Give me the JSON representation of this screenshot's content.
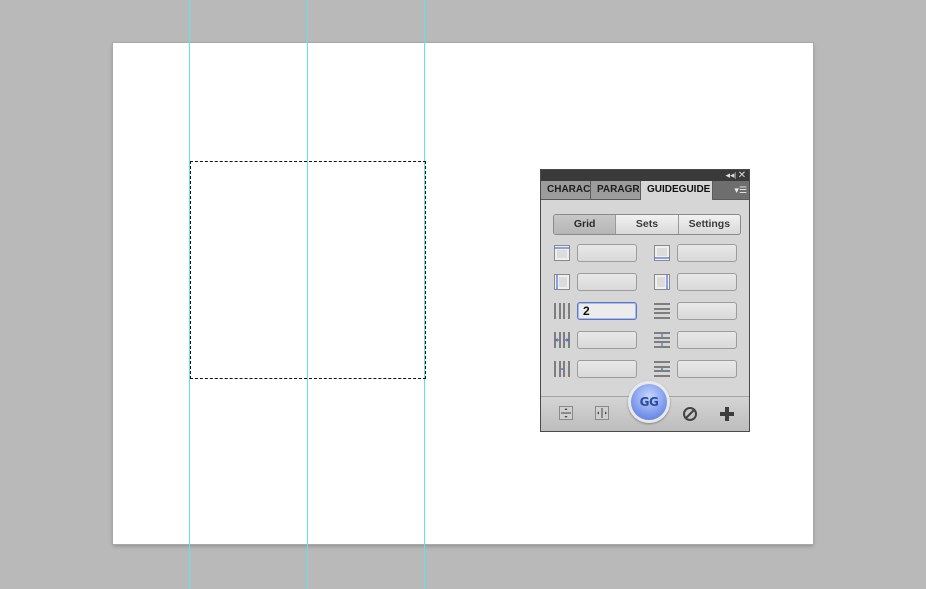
{
  "panel": {
    "tabs": [
      {
        "label": "CHARACTER"
      },
      {
        "label": "PARAGRAPH"
      },
      {
        "label": "GUIDEGUIDE"
      }
    ],
    "active_tab": "GUIDEGUIDE",
    "segments": [
      "Grid",
      "Sets",
      "Settings"
    ],
    "active_segment": "Grid",
    "fields": {
      "left_margin": "",
      "top_margin": "",
      "right_margin": "",
      "bottom_margin": "",
      "columns": "2",
      "rows": "",
      "column_width": "",
      "row_height": "",
      "column_gutter": "",
      "row_gutter": ""
    },
    "gg_button_label": "GG",
    "icons": {
      "collapse": "collapse-icon",
      "close": "close-icon",
      "menu": "panel-menu-icon"
    }
  },
  "colors": {
    "guide": "#5ee3e8",
    "accent": "#6f8fe8"
  }
}
